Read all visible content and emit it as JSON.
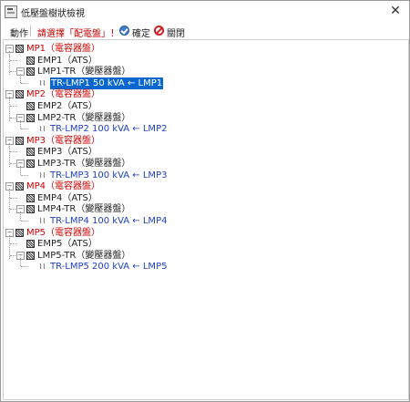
{
  "window": {
    "title": "低壓盤樹狀檢視",
    "close_glyph": "✕"
  },
  "toolbar": {
    "action_label": "動作",
    "prompt": "請選擇「配電盤」！",
    "ok_label": "確定",
    "close_label": "關閉"
  },
  "tree": [
    {
      "mp": "MP1（電容器盤）",
      "emp": "EMP1（ATS）",
      "lmp": "LMP1-TR（變壓器盤）",
      "tr": "TR-LMP1  50 kVA ← LMP1",
      "selected": true
    },
    {
      "mp": "MP2（電容器盤）",
      "emp": "EMP2（ATS）",
      "lmp": "LMP2-TR（變壓器盤）",
      "tr": "TR-LMP2  100 kVA ← LMP2",
      "selected": false
    },
    {
      "mp": "MP3（電容器盤）",
      "emp": "EMP3（ATS）",
      "lmp": "LMP3-TR（變壓器盤）",
      "tr": "TR-LMP3  100 kVA ← LMP3",
      "selected": false
    },
    {
      "mp": "MP4（電容器盤）",
      "emp": "EMP4（ATS）",
      "lmp": "LMP4-TR（變壓器盤）",
      "tr": "TR-LMP4  100 kVA ← LMP4",
      "selected": false
    },
    {
      "mp": "MP5（電容器盤）",
      "emp": "EMP5（ATS）",
      "lmp": "LMP5-TR（變壓器盤）",
      "tr": "TR-LMP5  200 kVA ← LMP5",
      "selected": false
    }
  ],
  "icons": {
    "expander": "minus-box",
    "checkbox": "checkbox-indeterminate",
    "transformer": "transformer-icon"
  },
  "colors": {
    "root": "#d00000",
    "child": "#222222",
    "leaf": "#1f3fc2",
    "selection": "#0a67d0"
  }
}
